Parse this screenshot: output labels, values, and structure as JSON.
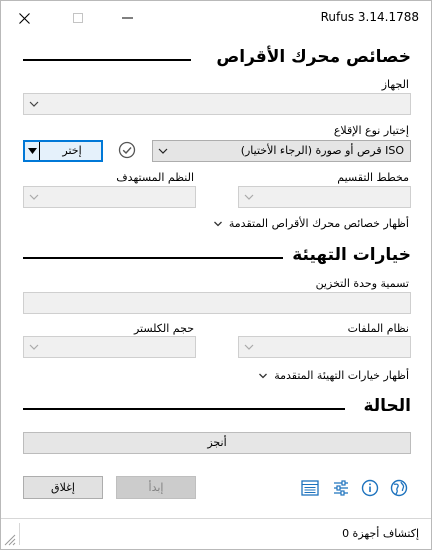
{
  "window": {
    "title": "Rufus 3.14.1788"
  },
  "drive_properties": {
    "header": "خصائص محرك الأقراص",
    "device_label": "الجهاز",
    "device_value": "",
    "boot_selection_label": "إختيار نوع الإقلاع",
    "boot_selection_value": "(الرجاء الأختيار) قرص أو صورة ISO",
    "select_button": "إختر",
    "partition_scheme_label": "مخطط التقسيم",
    "target_system_label": "النظم المستهدف",
    "advanced_toggle": "أظهار خصائص محرك الأقراص المتقدمة"
  },
  "format_options": {
    "header": "خيارات التهيئة",
    "volume_label": "تسمية وحدة التخزين",
    "volume_value": "",
    "file_system_label": "نظام الملفات",
    "cluster_size_label": "حجم الكلستر",
    "advanced_toggle": "أظهار خيارات التهيئة المتقدمة"
  },
  "status": {
    "header": "الحالة",
    "progress_text": "أنجز",
    "start_button": "إبدأ",
    "close_button": "إغلاق"
  },
  "statusbar": {
    "text": "إكتشاف أجهزة 0"
  },
  "colors": {
    "accent": "#0078d7",
    "icon_blue": "#1e73be"
  }
}
